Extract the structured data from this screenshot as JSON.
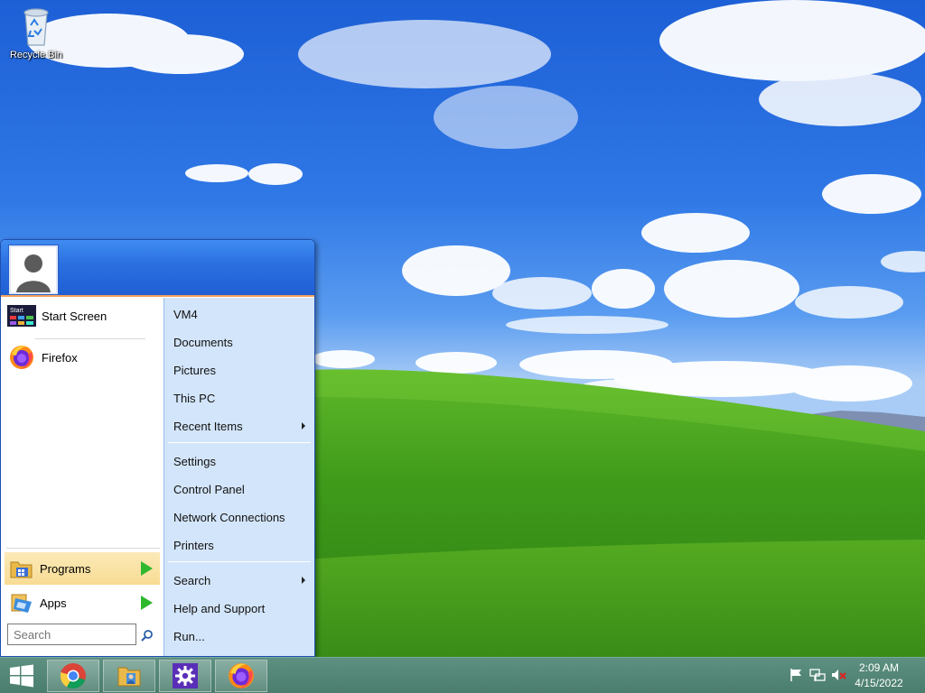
{
  "desktop": {
    "icons": [
      {
        "label": "Recycle Bin",
        "icon": "recycle-bin-icon"
      }
    ]
  },
  "start_menu": {
    "user": {
      "icon": "user-avatar-icon"
    },
    "pinned": [
      {
        "label": "Start Screen",
        "icon": "start-screen-icon",
        "icon_text": "Start"
      },
      {
        "label": "Firefox",
        "icon": "firefox-icon"
      }
    ],
    "nav": [
      {
        "label": "Programs",
        "icon": "programs-folder-icon",
        "highlighted": true
      },
      {
        "label": "Apps",
        "icon": "apps-icon",
        "highlighted": false
      }
    ],
    "search": {
      "placeholder": "Search"
    },
    "right_items": [
      {
        "label": "VM4"
      },
      {
        "label": "Documents"
      },
      {
        "label": "Pictures"
      },
      {
        "label": "This PC"
      },
      {
        "label": "Recent Items",
        "submenu": true
      },
      {
        "label": "Settings"
      },
      {
        "label": "Control Panel"
      },
      {
        "label": "Network Connections"
      },
      {
        "label": "Printers"
      },
      {
        "label": "Search",
        "submenu": true
      },
      {
        "label": "Help and Support"
      },
      {
        "label": "Run..."
      }
    ]
  },
  "taskbar": {
    "start_icon": "windows-logo-icon",
    "apps": [
      {
        "name": "Chrome",
        "icon": "chrome-icon"
      },
      {
        "name": "File Explorer",
        "icon": "file-explorer-icon"
      },
      {
        "name": "Settings",
        "icon": "settings-gear-icon"
      },
      {
        "name": "Firefox",
        "icon": "firefox-icon"
      }
    ],
    "tray_icons": [
      "flag-icon",
      "network-icon",
      "volume-muted-icon"
    ],
    "clock": {
      "time": "2:09 AM",
      "date": "4/15/2022"
    }
  },
  "colors": {
    "menu_header": "#2a6fe0",
    "menu_right_panel": "#d3e5fa",
    "highlight": "#f8dc94",
    "taskbar": "#4f8272"
  }
}
